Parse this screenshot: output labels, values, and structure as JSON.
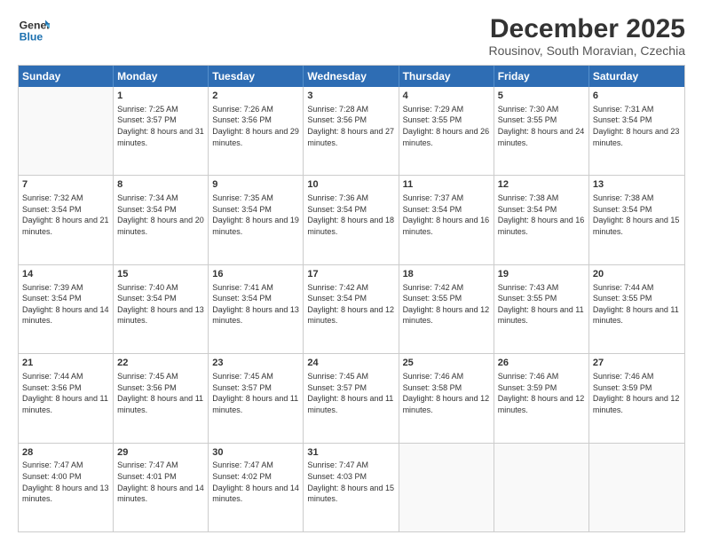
{
  "logo": {
    "line1": "General",
    "line2": "Blue"
  },
  "title": "December 2025",
  "subtitle": "Rousinov, South Moravian, Czechia",
  "header_days": [
    "Sunday",
    "Monday",
    "Tuesday",
    "Wednesday",
    "Thursday",
    "Friday",
    "Saturday"
  ],
  "weeks": [
    [
      {
        "day": "",
        "sunrise": "",
        "sunset": "",
        "daylight": ""
      },
      {
        "day": "1",
        "sunrise": "Sunrise: 7:25 AM",
        "sunset": "Sunset: 3:57 PM",
        "daylight": "Daylight: 8 hours and 31 minutes."
      },
      {
        "day": "2",
        "sunrise": "Sunrise: 7:26 AM",
        "sunset": "Sunset: 3:56 PM",
        "daylight": "Daylight: 8 hours and 29 minutes."
      },
      {
        "day": "3",
        "sunrise": "Sunrise: 7:28 AM",
        "sunset": "Sunset: 3:56 PM",
        "daylight": "Daylight: 8 hours and 27 minutes."
      },
      {
        "day": "4",
        "sunrise": "Sunrise: 7:29 AM",
        "sunset": "Sunset: 3:55 PM",
        "daylight": "Daylight: 8 hours and 26 minutes."
      },
      {
        "day": "5",
        "sunrise": "Sunrise: 7:30 AM",
        "sunset": "Sunset: 3:55 PM",
        "daylight": "Daylight: 8 hours and 24 minutes."
      },
      {
        "day": "6",
        "sunrise": "Sunrise: 7:31 AM",
        "sunset": "Sunset: 3:54 PM",
        "daylight": "Daylight: 8 hours and 23 minutes."
      }
    ],
    [
      {
        "day": "7",
        "sunrise": "Sunrise: 7:32 AM",
        "sunset": "Sunset: 3:54 PM",
        "daylight": "Daylight: 8 hours and 21 minutes."
      },
      {
        "day": "8",
        "sunrise": "Sunrise: 7:34 AM",
        "sunset": "Sunset: 3:54 PM",
        "daylight": "Daylight: 8 hours and 20 minutes."
      },
      {
        "day": "9",
        "sunrise": "Sunrise: 7:35 AM",
        "sunset": "Sunset: 3:54 PM",
        "daylight": "Daylight: 8 hours and 19 minutes."
      },
      {
        "day": "10",
        "sunrise": "Sunrise: 7:36 AM",
        "sunset": "Sunset: 3:54 PM",
        "daylight": "Daylight: 8 hours and 18 minutes."
      },
      {
        "day": "11",
        "sunrise": "Sunrise: 7:37 AM",
        "sunset": "Sunset: 3:54 PM",
        "daylight": "Daylight: 8 hours and 16 minutes."
      },
      {
        "day": "12",
        "sunrise": "Sunrise: 7:38 AM",
        "sunset": "Sunset: 3:54 PM",
        "daylight": "Daylight: 8 hours and 16 minutes."
      },
      {
        "day": "13",
        "sunrise": "Sunrise: 7:38 AM",
        "sunset": "Sunset: 3:54 PM",
        "daylight": "Daylight: 8 hours and 15 minutes."
      }
    ],
    [
      {
        "day": "14",
        "sunrise": "Sunrise: 7:39 AM",
        "sunset": "Sunset: 3:54 PM",
        "daylight": "Daylight: 8 hours and 14 minutes."
      },
      {
        "day": "15",
        "sunrise": "Sunrise: 7:40 AM",
        "sunset": "Sunset: 3:54 PM",
        "daylight": "Daylight: 8 hours and 13 minutes."
      },
      {
        "day": "16",
        "sunrise": "Sunrise: 7:41 AM",
        "sunset": "Sunset: 3:54 PM",
        "daylight": "Daylight: 8 hours and 13 minutes."
      },
      {
        "day": "17",
        "sunrise": "Sunrise: 7:42 AM",
        "sunset": "Sunset: 3:54 PM",
        "daylight": "Daylight: 8 hours and 12 minutes."
      },
      {
        "day": "18",
        "sunrise": "Sunrise: 7:42 AM",
        "sunset": "Sunset: 3:55 PM",
        "daylight": "Daylight: 8 hours and 12 minutes."
      },
      {
        "day": "19",
        "sunrise": "Sunrise: 7:43 AM",
        "sunset": "Sunset: 3:55 PM",
        "daylight": "Daylight: 8 hours and 11 minutes."
      },
      {
        "day": "20",
        "sunrise": "Sunrise: 7:44 AM",
        "sunset": "Sunset: 3:55 PM",
        "daylight": "Daylight: 8 hours and 11 minutes."
      }
    ],
    [
      {
        "day": "21",
        "sunrise": "Sunrise: 7:44 AM",
        "sunset": "Sunset: 3:56 PM",
        "daylight": "Daylight: 8 hours and 11 minutes."
      },
      {
        "day": "22",
        "sunrise": "Sunrise: 7:45 AM",
        "sunset": "Sunset: 3:56 PM",
        "daylight": "Daylight: 8 hours and 11 minutes."
      },
      {
        "day": "23",
        "sunrise": "Sunrise: 7:45 AM",
        "sunset": "Sunset: 3:57 PM",
        "daylight": "Daylight: 8 hours and 11 minutes."
      },
      {
        "day": "24",
        "sunrise": "Sunrise: 7:45 AM",
        "sunset": "Sunset: 3:57 PM",
        "daylight": "Daylight: 8 hours and 11 minutes."
      },
      {
        "day": "25",
        "sunrise": "Sunrise: 7:46 AM",
        "sunset": "Sunset: 3:58 PM",
        "daylight": "Daylight: 8 hours and 12 minutes."
      },
      {
        "day": "26",
        "sunrise": "Sunrise: 7:46 AM",
        "sunset": "Sunset: 3:59 PM",
        "daylight": "Daylight: 8 hours and 12 minutes."
      },
      {
        "day": "27",
        "sunrise": "Sunrise: 7:46 AM",
        "sunset": "Sunset: 3:59 PM",
        "daylight": "Daylight: 8 hours and 12 minutes."
      }
    ],
    [
      {
        "day": "28",
        "sunrise": "Sunrise: 7:47 AM",
        "sunset": "Sunset: 4:00 PM",
        "daylight": "Daylight: 8 hours and 13 minutes."
      },
      {
        "day": "29",
        "sunrise": "Sunrise: 7:47 AM",
        "sunset": "Sunset: 4:01 PM",
        "daylight": "Daylight: 8 hours and 14 minutes."
      },
      {
        "day": "30",
        "sunrise": "Sunrise: 7:47 AM",
        "sunset": "Sunset: 4:02 PM",
        "daylight": "Daylight: 8 hours and 14 minutes."
      },
      {
        "day": "31",
        "sunrise": "Sunrise: 7:47 AM",
        "sunset": "Sunset: 4:03 PM",
        "daylight": "Daylight: 8 hours and 15 minutes."
      },
      {
        "day": "",
        "sunrise": "",
        "sunset": "",
        "daylight": ""
      },
      {
        "day": "",
        "sunrise": "",
        "sunset": "",
        "daylight": ""
      },
      {
        "day": "",
        "sunrise": "",
        "sunset": "",
        "daylight": ""
      }
    ]
  ]
}
